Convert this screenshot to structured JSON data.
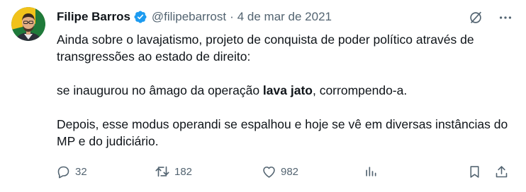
{
  "author": {
    "name": "Filipe Barros",
    "handle": "@filipebarrost",
    "separator": "·",
    "date": "4 de mar de 2021",
    "verified": true
  },
  "tweet": {
    "line1": "Ainda sobre o lavajatismo, projeto de conquista de poder político através de transgressões ao estado de direito:",
    "line2_before": "se inaugurou no âmago da operação ",
    "line2_bold": "lava jato",
    "line2_after": ", corrompendo-a.",
    "line3": "Depois, esse modus operandi se espalhou e hoje se vê em diversas instâncias do MP e do judiciário."
  },
  "metrics": {
    "replies": "32",
    "retweets": "182",
    "likes": "982"
  },
  "icons": {
    "verified": "verified-badge-icon",
    "grok": "grok-icon",
    "more": "more-icon",
    "reply": "reply-icon",
    "retweet": "retweet-icon",
    "like": "heart-icon",
    "views": "views-icon",
    "bookmark": "bookmark-icon",
    "share": "share-icon"
  },
  "colors": {
    "verified": "#1d9bf0",
    "text": "#0f1419",
    "muted": "#536471"
  }
}
